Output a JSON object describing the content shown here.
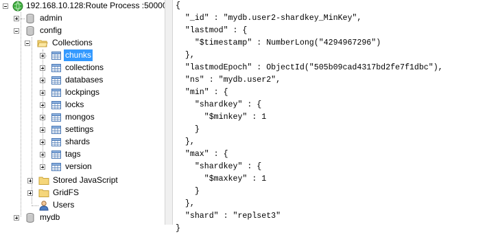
{
  "tree": {
    "server": "192.168.10.128:Route Process :50000",
    "databases": [
      {
        "label": "admin"
      },
      {
        "label": "config"
      }
    ],
    "config_children": {
      "collections_folder": "Collections",
      "collections": [
        "chunks",
        "collections",
        "databases",
        "lockpings",
        "locks",
        "mongos",
        "settings",
        "shards",
        "tags",
        "version"
      ],
      "stored_js": "Stored JavaScript",
      "gridfs": "GridFS",
      "users": "Users"
    },
    "last_db": "mydb",
    "selected": "chunks"
  },
  "document": {
    "lines": [
      "{",
      "  \"_id\" : \"mydb.user2-shardkey_MinKey\",",
      "  \"lastmod\" : {",
      "    \"$timestamp\" : NumberLong(\"4294967296\")",
      "  },",
      "  \"lastmodEpoch\" : ObjectId(\"505b09cad4317bd2fe7f1dbc\"),",
      "  \"ns\" : \"mydb.user2\",",
      "  \"min\" : {",
      "    \"shardkey\" : {",
      "      \"$minkey\" : 1",
      "    }",
      "  },",
      "  \"max\" : {",
      "    \"shardkey\" : {",
      "      \"$maxkey\" : 1",
      "    }",
      "  },",
      "  \"shard\" : \"replset3\"",
      "}"
    ]
  }
}
